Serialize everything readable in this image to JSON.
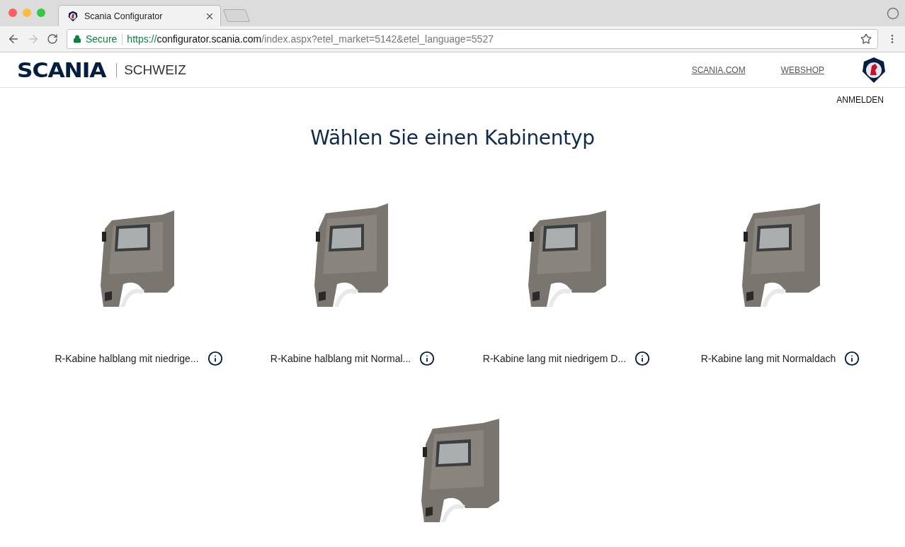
{
  "browser": {
    "tab_title": "Scania Configurator",
    "secure_label": "Secure",
    "url_scheme": "https://",
    "url_host": "configurator.scania.com",
    "url_path": "/index.aspx?etel_market=5142&etel_language=5527",
    "forward_disabled": true
  },
  "header": {
    "brand": "SCANIA",
    "market": "SCHWEIZ",
    "links": [
      "SCANIA.COM",
      "WEBSHOP"
    ]
  },
  "login": "ANMELDEN",
  "title": "Wählen Sie einen Kabinentyp",
  "cabs": [
    {
      "label": "R-Kabine halblang mit niedrige...",
      "kind": "short"
    },
    {
      "label": "R-Kabine halblang mit Normal...",
      "kind": "short-high"
    },
    {
      "label": "R-Kabine lang mit niedrigem D...",
      "kind": "long"
    },
    {
      "label": "R-Kabine lang mit Normaldach",
      "kind": "long-high"
    },
    {
      "kind": "highline"
    }
  ]
}
